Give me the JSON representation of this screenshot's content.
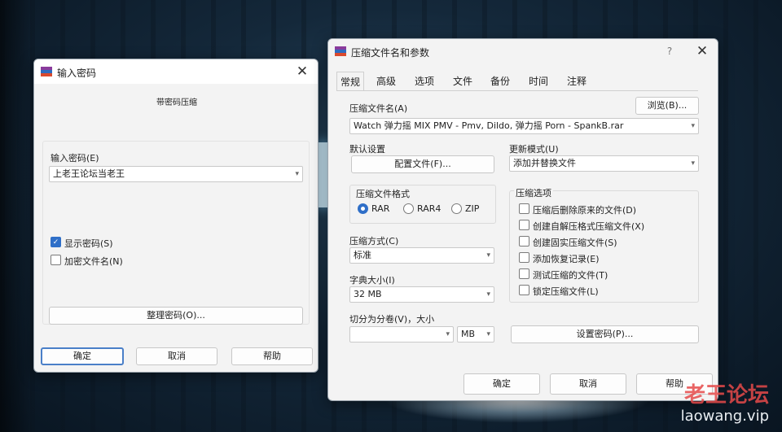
{
  "watermark": {
    "cn": "老王论坛",
    "en": "laowang.vip"
  },
  "pwd_dialog": {
    "title": "输入密码",
    "subtitle": "带密码压缩",
    "enter_password_label": "输入密码(E)",
    "password_value": "上老王论坛当老王",
    "show_password_label": "显示密码(S)",
    "show_password_checked": true,
    "encrypt_names_label": "加密文件名(N)",
    "encrypt_names_checked": false,
    "organize_button": "整理密码(O)...",
    "ok_button": "确定",
    "cancel_button": "取消",
    "help_button": "帮助"
  },
  "archive_dialog": {
    "title": "压缩文件名和参数",
    "help_glyph": "?",
    "tabs": [
      "常规",
      "高级",
      "选项",
      "文件",
      "备份",
      "时间",
      "注释"
    ],
    "active_tab": "常规",
    "archive_name_label": "压缩文件名(A)",
    "browse_button": "浏览(B)...",
    "archive_name_value": "Watch 弹力摇 MIX PMV - Pmv, Dildo, 弹力摇 Porn - SpankB.rar",
    "default_settings_label": "默认设置",
    "profiles_button": "配置文件(F)...",
    "update_mode_label": "更新模式(U)",
    "update_mode_value": "添加并替换文件",
    "format_group_label": "压缩文件格式",
    "formats": [
      "RAR",
      "RAR4",
      "ZIP"
    ],
    "selected_format": "RAR",
    "options_group_label": "压缩选项",
    "options": [
      "压缩后删除原来的文件(D)",
      "创建自解压格式压缩文件(X)",
      "创建固实压缩文件(S)",
      "添加恢复记录(E)",
      "测试压缩的文件(T)",
      "锁定压缩文件(L)"
    ],
    "method_label": "压缩方式(C)",
    "method_value": "标准",
    "dict_label": "字典大小(I)",
    "dict_value": "32 MB",
    "split_label": "切分为分卷(V)，大小",
    "split_value": "",
    "split_unit": "MB",
    "set_password_button": "设置密码(P)...",
    "ok_button": "确定",
    "cancel_button": "取消",
    "help_button": "帮助"
  }
}
